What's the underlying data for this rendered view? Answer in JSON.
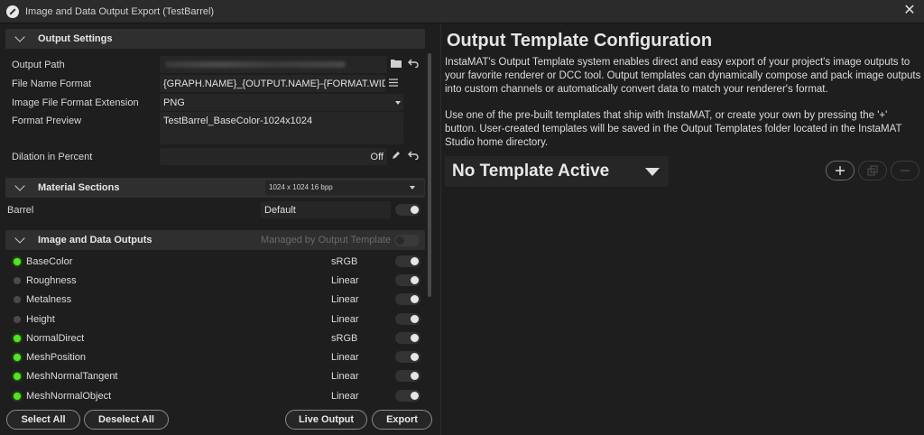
{
  "window": {
    "title": "Image and Data Output Export (TestBarrel)"
  },
  "output_settings": {
    "title": "Output Settings",
    "output_path_label": "Output Path",
    "file_name_format_label": "File Name Format",
    "file_name_format_value": "{GRAPH.NAME}_{OUTPUT.NAME}-{FORMAT.WIDTH}",
    "image_format_label": "Image File Format Extension",
    "image_format_value": "PNG",
    "format_preview_label": "Format Preview",
    "format_preview_value": "TestBarrel_BaseColor-1024x1024",
    "dilation_label": "Dilation in Percent",
    "dilation_value": "Off"
  },
  "material_sections": {
    "title": "Material Sections",
    "resolution": "1024 x 1024 16 bpp",
    "rows": [
      {
        "name": "Barrel",
        "value": "Default"
      }
    ]
  },
  "outputs": {
    "title": "Image and Data Outputs",
    "managed_label": "Managed by Output Template",
    "items": [
      {
        "name": "BaseColor",
        "space": "sRGB",
        "active": true
      },
      {
        "name": "Roughness",
        "space": "Linear",
        "active": false
      },
      {
        "name": "Metalness",
        "space": "Linear",
        "active": false
      },
      {
        "name": "Height",
        "space": "Linear",
        "active": false
      },
      {
        "name": "NormalDirect",
        "space": "sRGB",
        "active": true
      },
      {
        "name": "MeshPosition",
        "space": "Linear",
        "active": true
      },
      {
        "name": "MeshNormalTangent",
        "space": "Linear",
        "active": true
      },
      {
        "name": "MeshNormalObject",
        "space": "Linear",
        "active": true
      }
    ]
  },
  "buttons": {
    "select_all": "Select All",
    "deselect_all": "Deselect All",
    "live_output": "Live Output",
    "export": "Export"
  },
  "template_panel": {
    "title": "Output Template Configuration",
    "para1": "InstaMAT's Output Template system enables direct and easy export of your project's image outputs to your favorite renderer or DCC tool. Output templates can dynamically compose and pack image outputs into custom channels or automatically convert data to match your renderer's format.",
    "para2": "Use one of the pre-built templates that ship with InstaMAT, or create your own by pressing the '+' button. User-created templates will be saved in the Output Templates folder located in the InstaMAT Studio home directory.",
    "active_template": "No Template Active"
  }
}
